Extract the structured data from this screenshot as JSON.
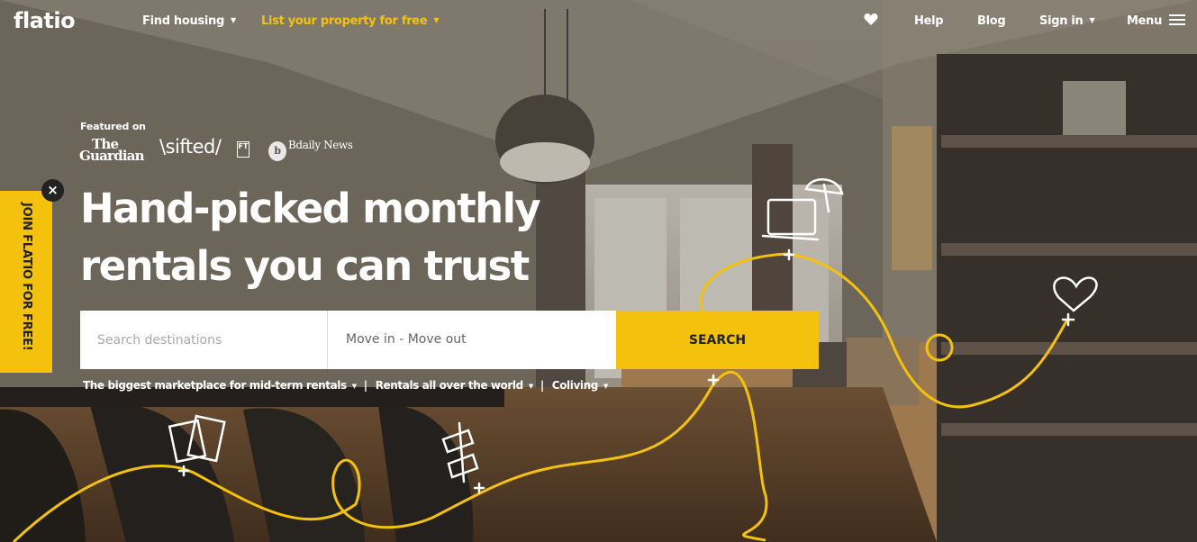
{
  "header": {
    "logo": "flatio",
    "nav": {
      "find_housing": "Find housing",
      "list_property": "List your property for free",
      "help": "Help",
      "blog": "Blog",
      "sign_in": "Sign in",
      "menu": "Menu"
    },
    "icons": {
      "favorites": "heart-icon",
      "menu": "hamburger-icon",
      "dropdown": "chevron-down-icon"
    }
  },
  "featured": {
    "label": "Featured on",
    "logos": {
      "guardian_line1": "The",
      "guardian_line2": "Guardian",
      "sifted": "\\sifted/",
      "ft": "FT",
      "bdaily_mark": "b",
      "bdaily": "Bdaily News"
    }
  },
  "hero": {
    "title": "Hand-picked monthly\nrentals you can trust"
  },
  "search": {
    "destination_placeholder": "Search destinations",
    "dates_label": "Move in - Move out",
    "button_label": "SEARCH"
  },
  "sublinks": {
    "marketplace": "The biggest marketplace for mid-term rentals",
    "worldwide": "Rentals all over the world",
    "coliving": "Coliving",
    "separator": "|"
  },
  "join": {
    "label": "JOIN FLATIO FOR FREE!",
    "close": "×"
  },
  "colors": {
    "accent": "#f4c20d",
    "text_light": "#ffffff",
    "text_dark": "#222222"
  }
}
